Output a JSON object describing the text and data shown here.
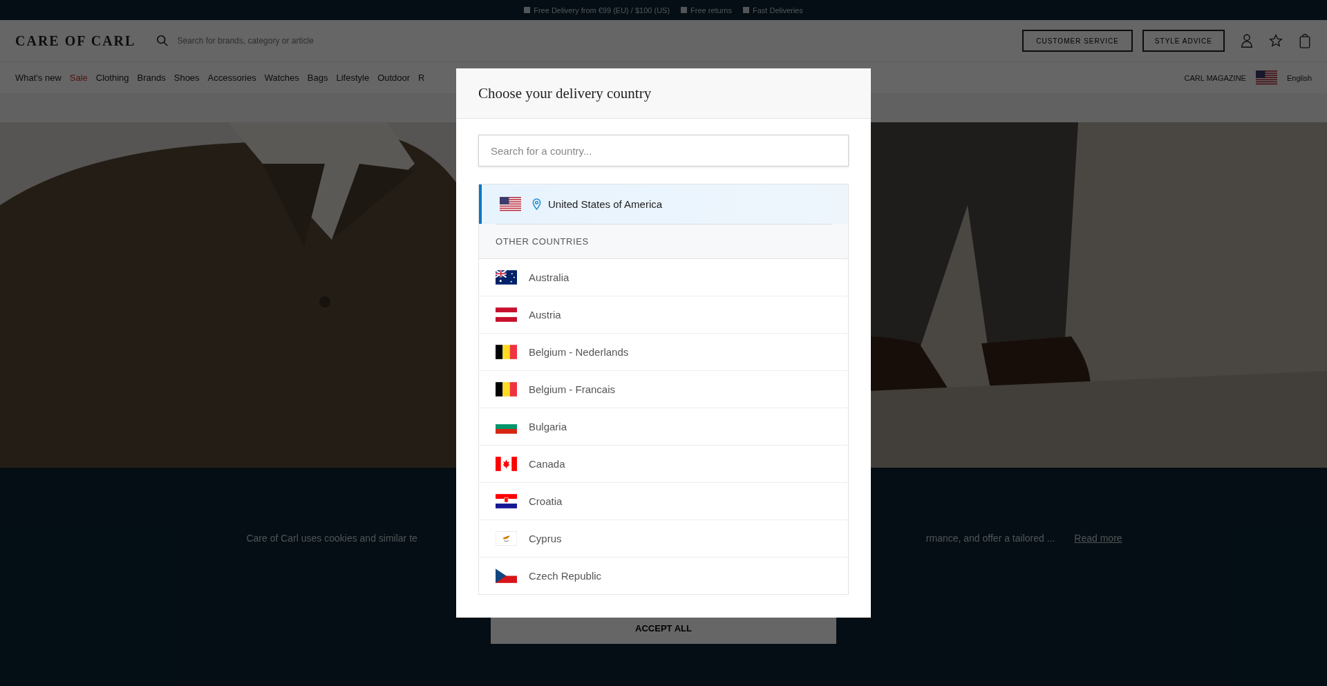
{
  "announcement_bar": {
    "items": [
      "Free Delivery from €99 (EU) / $100 (US)",
      "Free returns",
      "Fast Deliveries"
    ]
  },
  "header": {
    "logo": "CARE OF CARL",
    "search": {
      "placeholder": "Search for brands, category or article"
    },
    "buttons": [
      "CUSTOMER SERVICE",
      "STYLE ADVICE"
    ]
  },
  "nav": {
    "items": [
      {
        "label": "What's new",
        "kind": "normal"
      },
      {
        "label": "Sale",
        "kind": "sale"
      },
      {
        "label": "Clothing",
        "kind": "normal"
      },
      {
        "label": "Brands",
        "kind": "normal"
      },
      {
        "label": "Shoes",
        "kind": "normal"
      },
      {
        "label": "Accessories",
        "kind": "normal"
      },
      {
        "label": "Watches",
        "kind": "normal"
      },
      {
        "label": "Bags",
        "kind": "normal"
      },
      {
        "label": "Lifestyle",
        "kind": "normal"
      },
      {
        "label": "Outdoor",
        "kind": "normal"
      },
      {
        "label": "R",
        "kind": "normal"
      }
    ],
    "magazine": "CARL MAGAZINE",
    "language": "English"
  },
  "cookie_banner": {
    "text_left": "Care of Carl uses cookies and similar te",
    "text_right": "rmance, and offer a tailored ...",
    "link": "Read more",
    "button": "ACCEPT ALL"
  },
  "dialog": {
    "title": "Choose your delivery country",
    "search": {
      "placeholder": "Search for a country..."
    },
    "current": {
      "name": "United States of America",
      "kind": "us",
      "selected": true
    },
    "section_label": "OTHER COUNTRIES",
    "countries": [
      {
        "name": "Australia",
        "kind": "au",
        "selected": false
      },
      {
        "name": "Austria",
        "kind": "at",
        "selected": false
      },
      {
        "name": "Belgium - Nederlands",
        "kind": "be",
        "selected": false
      },
      {
        "name": "Belgium - Francais",
        "kind": "be",
        "selected": false
      },
      {
        "name": "Bulgaria",
        "kind": "bg",
        "selected": false
      },
      {
        "name": "Canada",
        "kind": "ca",
        "selected": false
      },
      {
        "name": "Croatia",
        "kind": "hr",
        "selected": false
      },
      {
        "name": "Cyprus",
        "kind": "cy",
        "selected": false
      },
      {
        "name": "Czech Republic",
        "kind": "cz",
        "selected": false
      }
    ]
  }
}
